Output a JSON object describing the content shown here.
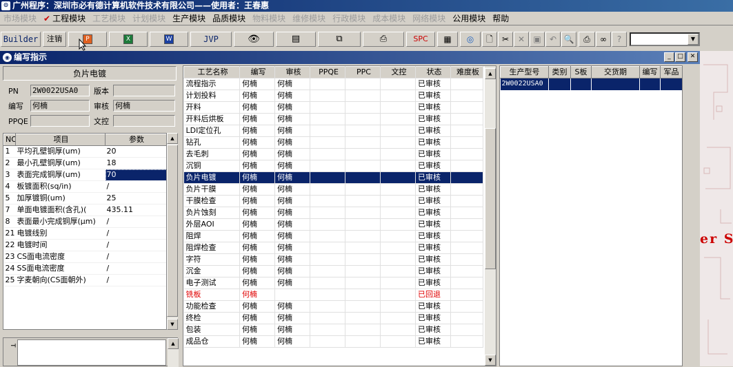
{
  "titlebar": {
    "title": "广州程序：深圳市必有德计算机软件技术有限公司——使用者：王春惠"
  },
  "menu": [
    {
      "label": "市场模块",
      "enabled": false
    },
    {
      "label": "工程模块",
      "enabled": true,
      "checked": true
    },
    {
      "label": "工艺模块",
      "enabled": false
    },
    {
      "label": "计划模块",
      "enabled": false
    },
    {
      "label": "生产模块",
      "enabled": true
    },
    {
      "label": "品质模块",
      "enabled": true
    },
    {
      "label": "物料模块",
      "enabled": false
    },
    {
      "label": "维修模块",
      "enabled": false
    },
    {
      "label": "行政模块",
      "enabled": false
    },
    {
      "label": "成本模块",
      "enabled": false
    },
    {
      "label": "网络模块",
      "enabled": false
    },
    {
      "label": "公用模块",
      "enabled": true
    },
    {
      "label": "帮助",
      "enabled": true
    }
  ],
  "toolbar": {
    "builder": "Builder",
    "logout": "注销",
    "jvp": "JVP",
    "spc": "SPC"
  },
  "window": {
    "title": "编写指示"
  },
  "header": {
    "section": "负片电镀",
    "pn_label": "PN",
    "pn_value": "2W0022USA0",
    "version_label": "版本",
    "version_value": "",
    "writer_label": "编写",
    "writer_value": "何楠",
    "reviewer_label": "审核",
    "reviewer_value": "何楠",
    "ppqe_label": "PPQE",
    "ppqe_value": "",
    "doc_label": "文控",
    "doc_value": ""
  },
  "params": {
    "columns": [
      "NO",
      "项目",
      "参数"
    ],
    "rows": [
      [
        "1",
        "平均孔壁铜厚(um)",
        "20"
      ],
      [
        "2",
        "最小孔壁铜厚(um)",
        "18"
      ],
      [
        "3",
        "表面完成铜厚(um)",
        "70"
      ],
      [
        "4",
        "板镀面积(sq/in)",
        "/"
      ],
      [
        "5",
        "加厚镀铜(um)",
        "25"
      ],
      [
        "7",
        "单面电镀面积(含孔)(",
        "435.11"
      ],
      [
        "8",
        "表面最小完成铜厚(μm)",
        "/"
      ],
      [
        "21",
        "电镀线别",
        "/"
      ],
      [
        "22",
        "电镀时间",
        "/"
      ],
      [
        "23",
        "CS面电流密度",
        "/"
      ],
      [
        "24",
        "SS面电流密度",
        "/"
      ],
      [
        "25",
        "字麦朝向(CS面朝外)",
        "/"
      ]
    ],
    "selected_index": 2
  },
  "process": {
    "columns": [
      "工艺名称",
      "编写",
      "审核",
      "PPQE",
      "PPC",
      "文控",
      "状态",
      "难度板"
    ],
    "rows": [
      [
        "流程指示",
        "何楠",
        "何楠",
        "",
        "",
        "",
        "已审核",
        ""
      ],
      [
        "计划投料",
        "何楠",
        "何楠",
        "",
        "",
        "",
        "已审核",
        ""
      ],
      [
        "开料",
        "何楠",
        "何楠",
        "",
        "",
        "",
        "已审核",
        ""
      ],
      [
        "开料后烘板",
        "何楠",
        "何楠",
        "",
        "",
        "",
        "已审核",
        ""
      ],
      [
        "LDI定位孔",
        "何楠",
        "何楠",
        "",
        "",
        "",
        "已审核",
        ""
      ],
      [
        "钻孔",
        "何楠",
        "何楠",
        "",
        "",
        "",
        "已审核",
        ""
      ],
      [
        "去毛刺",
        "何楠",
        "何楠",
        "",
        "",
        "",
        "已审核",
        ""
      ],
      [
        "沉铜",
        "何楠",
        "何楠",
        "",
        "",
        "",
        "已审核",
        ""
      ],
      [
        "负片电镀",
        "何楠",
        "何楠",
        "",
        "",
        "",
        "已审核",
        ""
      ],
      [
        "负片干膜",
        "何楠",
        "何楠",
        "",
        "",
        "",
        "已审核",
        ""
      ],
      [
        "干膜检查",
        "何楠",
        "何楠",
        "",
        "",
        "",
        "已审核",
        ""
      ],
      [
        "负片蚀刻",
        "何楠",
        "何楠",
        "",
        "",
        "",
        "已审核",
        ""
      ],
      [
        "外层AOI",
        "何楠",
        "何楠",
        "",
        "",
        "",
        "已审核",
        ""
      ],
      [
        "阻焊",
        "何楠",
        "何楠",
        "",
        "",
        "",
        "已审核",
        ""
      ],
      [
        "阻焊检查",
        "何楠",
        "何楠",
        "",
        "",
        "",
        "已审核",
        ""
      ],
      [
        "字符",
        "何楠",
        "何楠",
        "",
        "",
        "",
        "已审核",
        ""
      ],
      [
        "沉金",
        "何楠",
        "何楠",
        "",
        "",
        "",
        "已审核",
        ""
      ],
      [
        "电子测试",
        "何楠",
        "何楠",
        "",
        "",
        "",
        "已审核",
        ""
      ],
      [
        "铣板",
        "何楠",
        "",
        "",
        "",
        "",
        "已回退",
        ""
      ],
      [
        "功能检查",
        "何楠",
        "何楠",
        "",
        "",
        "",
        "已审核",
        ""
      ],
      [
        "终检",
        "何楠",
        "何楠",
        "",
        "",
        "",
        "已审核",
        ""
      ],
      [
        "包装",
        "何楠",
        "何楠",
        "",
        "",
        "",
        "已审核",
        ""
      ],
      [
        "成品仓",
        "何楠",
        "何楠",
        "",
        "",
        "",
        "已审核",
        ""
      ]
    ],
    "selected_index": 8,
    "returned_index": 18
  },
  "orders": {
    "columns": [
      "生产型号",
      "类别",
      "S板",
      "交货期",
      "编写",
      "军品"
    ],
    "rows": [
      [
        "2W0022USA0",
        "",
        "",
        "",
        "",
        ""
      ]
    ]
  },
  "background_text": "er S",
  "colors": {
    "selection": "#0a246a",
    "returned": "#e00000",
    "titlebar": "#0a246a"
  }
}
